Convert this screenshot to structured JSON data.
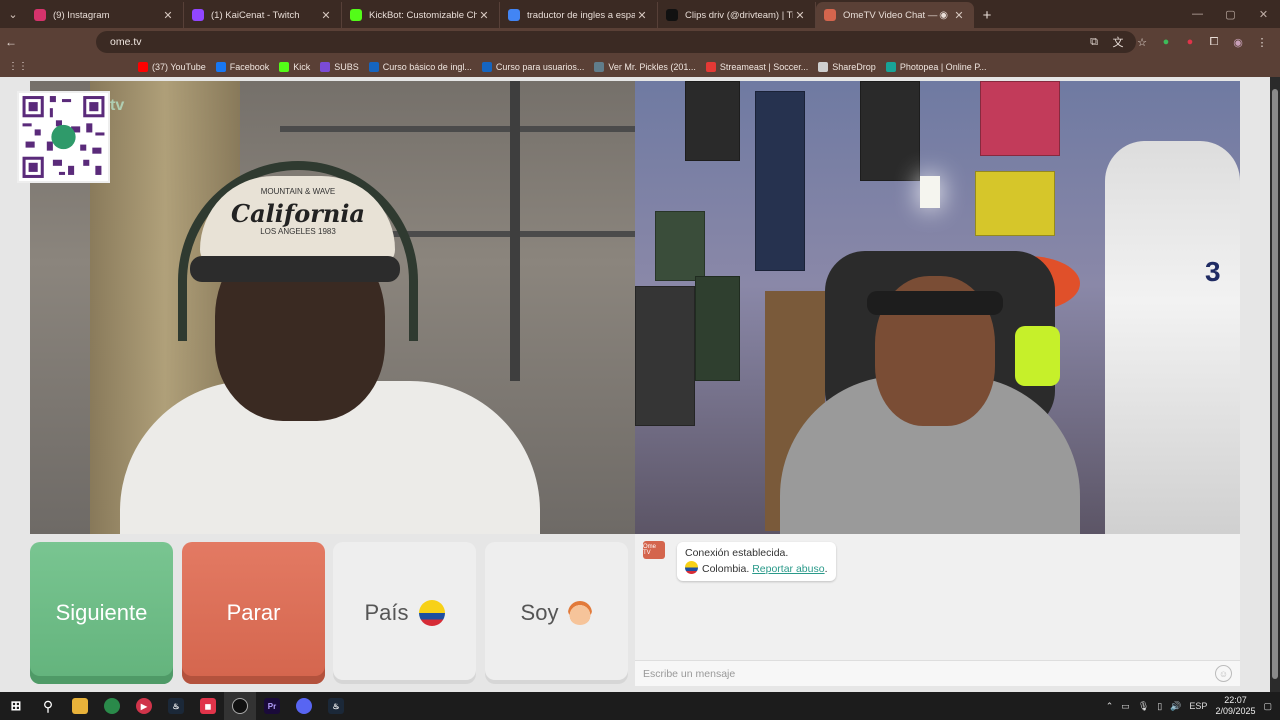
{
  "browser": {
    "tabs": [
      {
        "title": "(9) Instagram",
        "icon": "instagram-icon",
        "color": "#d6336c",
        "active": false
      },
      {
        "title": "(1) KaiCenat - Twitch",
        "icon": "twitch-icon",
        "color": "#9146ff",
        "active": false
      },
      {
        "title": "KickBot: Customizable Chat Bot",
        "icon": "kickbot-icon",
        "color": "#53fc18",
        "active": false
      },
      {
        "title": "traductor de ingles a español -",
        "icon": "google-icon",
        "color": "#4285f4",
        "active": false
      },
      {
        "title": "Clips driv (@drivteam) | TikTok",
        "icon": "tiktok-icon",
        "color": "#111111",
        "active": false
      },
      {
        "title": "OmeTV Video Chat — Ome",
        "icon": "ometv-icon",
        "color": "#d4654d",
        "active": true
      }
    ],
    "url": "ome.tv",
    "bookmarks": [
      {
        "label": "(37) YouTube",
        "icon": "youtube-icon",
        "color": "#ff0000"
      },
      {
        "label": "Facebook",
        "icon": "facebook-icon",
        "color": "#1877f2"
      },
      {
        "label": "Kick",
        "icon": "kick-icon",
        "color": "#53fc18"
      },
      {
        "label": "SUBS",
        "icon": "subs-icon",
        "color": "#7b4bd6"
      },
      {
        "label": "Curso básico de ingl...",
        "icon": "course-icon",
        "color": "#1565c0"
      },
      {
        "label": "Curso para usuarios...",
        "icon": "course-icon",
        "color": "#1565c0"
      },
      {
        "label": "Ver Mr. Pickles (201...",
        "icon": "tv-icon",
        "color": "#607d8b"
      },
      {
        "label": "Streameast | Soccer...",
        "icon": "streameast-icon",
        "color": "#e53935"
      },
      {
        "label": "ShareDrop",
        "icon": "sharedrop-icon",
        "color": "#cfcfcf"
      },
      {
        "label": "Photopea | Online P...",
        "icon": "photopea-icon",
        "color": "#18a497"
      }
    ]
  },
  "video": {
    "logo": "Ome.tv",
    "cap_text": "California",
    "cap_top": "MOUNTAIN & WAVE",
    "cap_sub": "LOS ANGELES 1983",
    "jersey_number": "3"
  },
  "controls": {
    "next_label": "Siguiente",
    "stop_label": "Parar",
    "country_label": "País",
    "gender_label": "Soy"
  },
  "chat": {
    "icon_label": "Ome TV",
    "connected": "Conexión establecida.",
    "country": "Colombia.",
    "report_link": "Reportar abuso",
    "input_placeholder": "Escribe un mensaje"
  },
  "taskbar": {
    "language": "ESP",
    "time": "22:07",
    "date": "2/09/2025"
  },
  "colors": {
    "next": "#6bbd84",
    "stop": "#d86a52",
    "accent_link": "#2a9a8a"
  }
}
